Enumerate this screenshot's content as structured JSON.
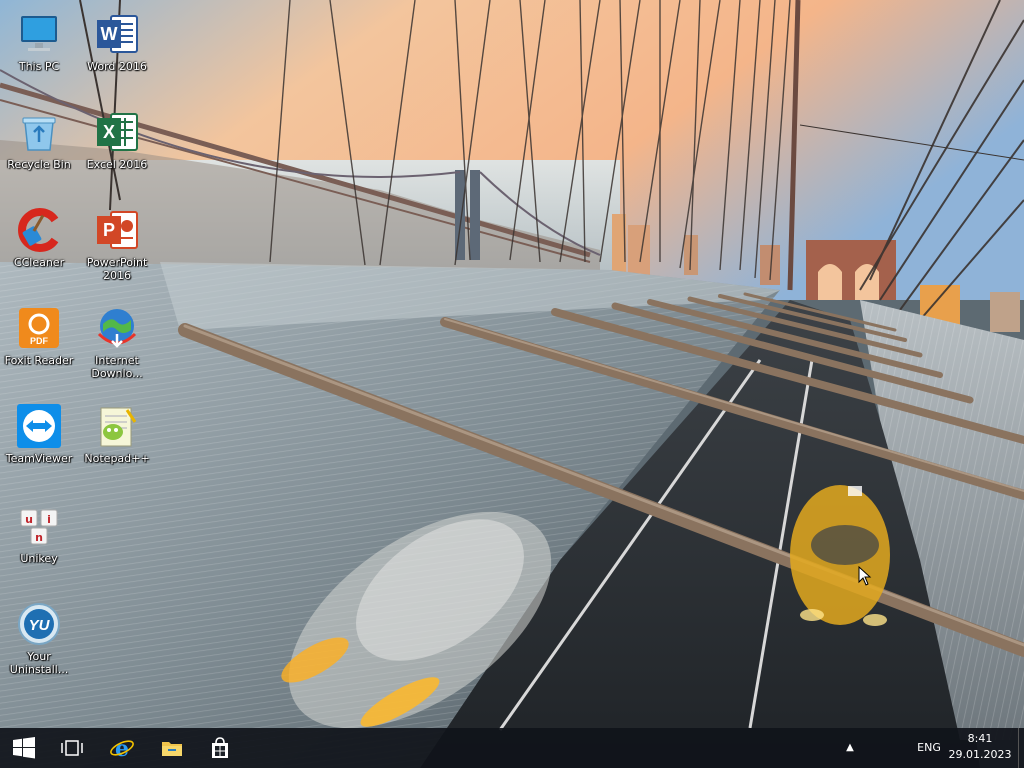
{
  "desktop": {
    "icons": [
      {
        "label": "This PC",
        "icon": "computer-icon"
      },
      {
        "label": "Word 2016",
        "icon": "word-icon"
      },
      {
        "label": "Recycle Bin",
        "icon": "recycle-bin-icon"
      },
      {
        "label": "Excel 2016",
        "icon": "excel-icon"
      },
      {
        "label": "CCleaner",
        "icon": "ccleaner-icon"
      },
      {
        "label": "PowerPoint 2016",
        "icon": "powerpoint-icon"
      },
      {
        "label": "Foxit Reader",
        "icon": "foxit-reader-icon"
      },
      {
        "label": "Internet Downlo...",
        "icon": "internet-download-manager-icon"
      },
      {
        "label": "TeamViewer",
        "icon": "teamviewer-icon"
      },
      {
        "label": "Notepad++",
        "icon": "notepad-plus-plus-icon"
      },
      {
        "label": "Unikey",
        "icon": "unikey-icon"
      },
      {
        "label": "Your Uninstall...",
        "icon": "your-uninstaller-icon"
      }
    ]
  },
  "taskbar": {
    "buttons": [
      {
        "icon": "windows-start-icon"
      },
      {
        "icon": "task-view-icon"
      },
      {
        "icon": "internet-explorer-icon"
      },
      {
        "icon": "file-explorer-icon"
      },
      {
        "icon": "windows-store-icon"
      }
    ],
    "tray": {
      "chevron": "▲",
      "language": "ENG",
      "time": "8:41",
      "date": "29.01.2023"
    }
  },
  "colors": {
    "taskbar_bg": "#10141a",
    "word": "#2b579a",
    "excel": "#217346",
    "powerpoint": "#d24726",
    "foxit": "#f08a1c",
    "teamviewer": "#0e8ee9"
  }
}
